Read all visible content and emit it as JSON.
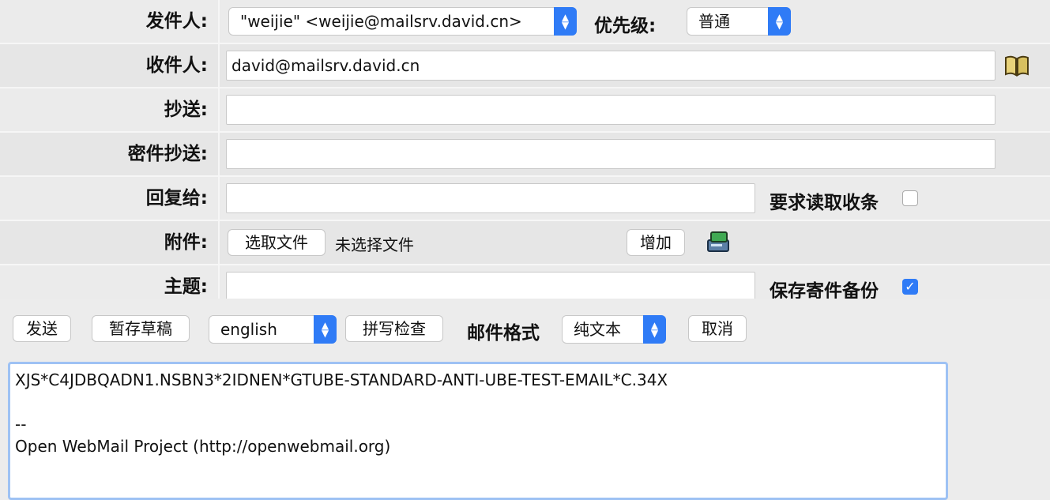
{
  "form": {
    "sender": {
      "label": "发件人:",
      "value": "\"weijie\" <weijie@mailsrv.david.cn>"
    },
    "priority": {
      "label": "优先级:",
      "value": "普通"
    },
    "to": {
      "label": "收件人:",
      "value": "david@mailsrv.david.cn",
      "icon": "address-book-icon"
    },
    "cc": {
      "label": "抄送:",
      "value": ""
    },
    "bcc": {
      "label": "密件抄送:",
      "value": ""
    },
    "reply_to": {
      "label": "回复给:",
      "value": ""
    },
    "read_receipt": {
      "label": "要求读取收条",
      "checked": false
    },
    "attachment": {
      "label": "附件:",
      "choose_button": "选取文件",
      "no_file_text": "未选择文件",
      "add_button": "增加",
      "icon": "attachment-drive-icon"
    },
    "subject": {
      "label": "主题:",
      "value": ""
    },
    "save_copy": {
      "label": "保存寄件备份",
      "checked": true
    }
  },
  "toolbar": {
    "send": "发送",
    "save_draft": "暂存草稿",
    "language": "english",
    "spell_check": "拼写检查",
    "format_label": "邮件格式",
    "format_value": "纯文本",
    "cancel": "取消"
  },
  "body": {
    "text": "XJS*C4JDBQADN1.NSBN3*2IDNEN*GTUBE-STANDARD-ANTI-UBE-TEST-EMAIL*C.34X\n\n--\nOpen WebMail Project (http://openwebmail.org)"
  },
  "colors": {
    "accent": "#2f7bf6",
    "row_bg": "#e6e6e6",
    "page_bg": "#ececec"
  }
}
